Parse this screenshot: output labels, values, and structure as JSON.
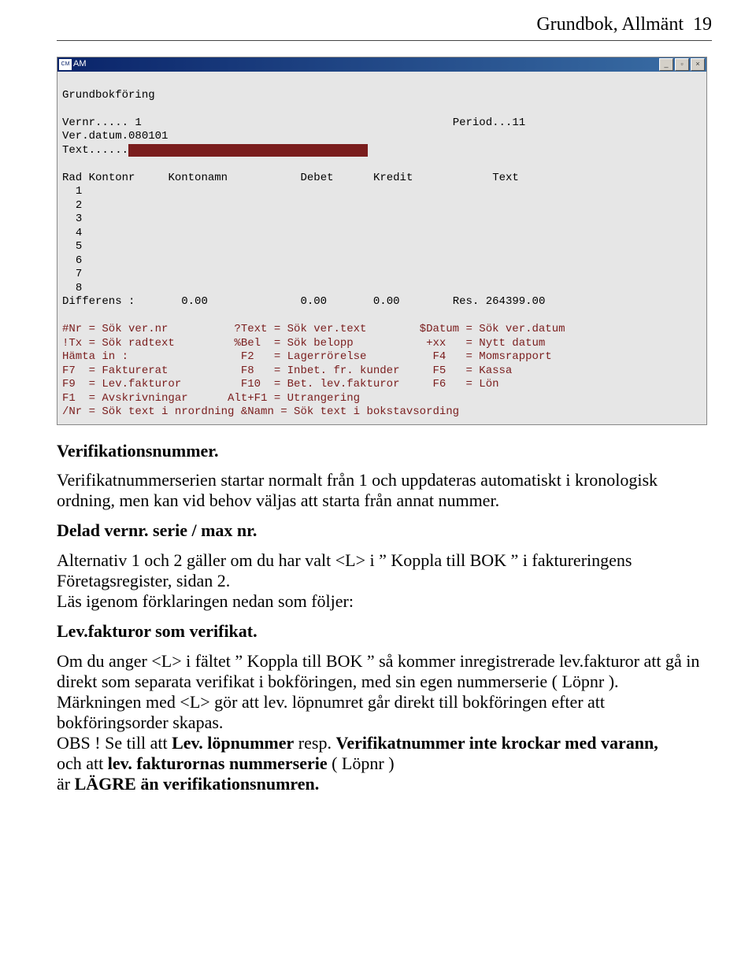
{
  "header": {
    "title": "Grundbok, Allmänt",
    "page": "19"
  },
  "window": {
    "iconText": "CM",
    "title": "AM",
    "screenTitle": "Grundbokföring",
    "fields": {
      "vernrLabel": "Vernr.....",
      "vernrValue": "1",
      "periodLabel": "Period...",
      "periodValue": "11",
      "verdatumLabel": "Ver.datum.",
      "verdatumValue": "080101",
      "textLabel": "Text......",
      "textValue": "                                    "
    },
    "columns": {
      "rad": "Rad",
      "kontonr": "Kontonr",
      "kontonamn": "Kontonamn",
      "debet": "Debet",
      "kredit": "Kredit",
      "text": "Text"
    },
    "rows": [
      "1",
      "2",
      "3",
      "4",
      "5",
      "6",
      "7",
      "8"
    ],
    "differens": {
      "label": "Differens :",
      "v1": "0.00",
      "v2": "0.00",
      "v3": "0.00",
      "resLabel": "Res.",
      "resValue": "264399.00"
    },
    "hints": [
      "#Nr = Sök ver.nr          ?Text = Sök ver.text        $Datum = Sök ver.datum",
      "!Tx = Sök radtext         %Bel  = Sök belopp           +xx   = Nytt datum",
      "Hämta in :                 F2   = Lagerrörelse          F4   = Momsrapport",
      "F7  = Fakturerat           F8   = Inbet. fr. kunder     F5   = Kassa",
      "F9  = Lev.fakturor         F10  = Bet. lev.fakturor     F6   = Lön",
      "F1  = Avskrivningar      Alt+F1 = Utrangering",
      "/Nr = Sök text i nrordning &Namn = Sök text i bokstavsording"
    ]
  },
  "prose": {
    "h1": "Verifikationsnummer.",
    "p1": "Verifikatnummerserien startar normalt från 1 och uppdateras automatiskt i kronologisk ordning, men kan vid behov väljas att starta från annat nummer.",
    "h2": "Delad vernr. serie / max nr.",
    "p2a": "Alternativ 1 och 2 gäller om du har valt <L> i ” Koppla till BOK ” i faktureringens Företagsregister, sidan 2.",
    "p2b": "Läs igenom förklaringen nedan som följer:",
    "h3": "Lev.fakturor som verifikat.",
    "p3a": "Om du anger <L> i fältet ” Koppla till BOK ” så kommer inregistrerade lev.fakturor att gå in direkt som separata verifikat i bokföringen, med sin egen nummerserie ( Löpnr ).",
    "p3b": "Märkningen med <L> gör att lev. löpnumret går direkt till bokföringen efter att bokföringsorder skapas.",
    "p3c_a": "OBS ! Se till att ",
    "p3c_b": "Lev. löpnummer",
    "p3c_c": " resp. ",
    "p3c_d": "Verifikatnummer inte krockar med varann,",
    "p3d_a": "och att ",
    "p3d_b": "lev. fakturornas nummerserie",
    "p3d_c": " ( Löpnr )",
    "p3e_a": "är  ",
    "p3e_b": "LÄGRE än verifikationsnumren."
  }
}
